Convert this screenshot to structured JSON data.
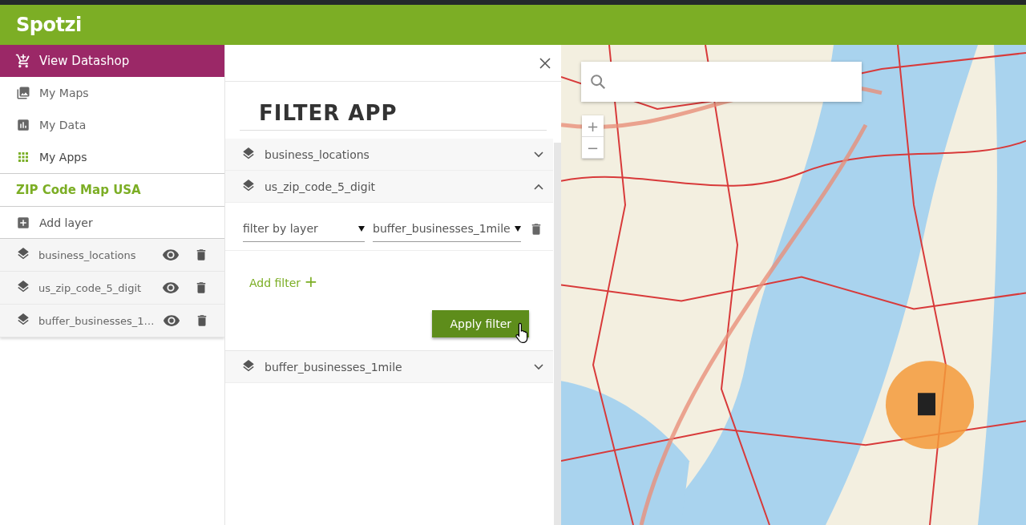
{
  "header": {
    "logo": "Spotzi"
  },
  "sidebar": {
    "datashop": {
      "label": "View Datashop"
    },
    "nav": [
      {
        "label": "My Maps",
        "kind": "maps",
        "selected": false
      },
      {
        "label": "My Data",
        "kind": "data",
        "selected": false
      },
      {
        "label": "My Apps",
        "kind": "apps",
        "selected": true
      }
    ],
    "map_title": "ZIP Code Map USA",
    "add_layer": "Add layer",
    "layers": [
      {
        "name": "business_locations"
      },
      {
        "name": "us_zip_code_5_digit"
      },
      {
        "name": "buffer_businesses_1…"
      }
    ]
  },
  "filter_panel": {
    "title": "FILTER APP",
    "sections": [
      {
        "name": "business_locations",
        "expanded": false
      },
      {
        "name": "us_zip_code_5_digit",
        "expanded": true,
        "filters": [
          {
            "field": "filter by layer",
            "value": "buffer_businesses_1mile"
          }
        ],
        "add_filter": "Add filter",
        "add_icon": "+",
        "apply": "Apply filter"
      },
      {
        "name": "buffer_businesses_1mile",
        "expanded": false
      }
    ]
  },
  "map": {
    "zoom_in": "+",
    "zoom_out": "−"
  }
}
